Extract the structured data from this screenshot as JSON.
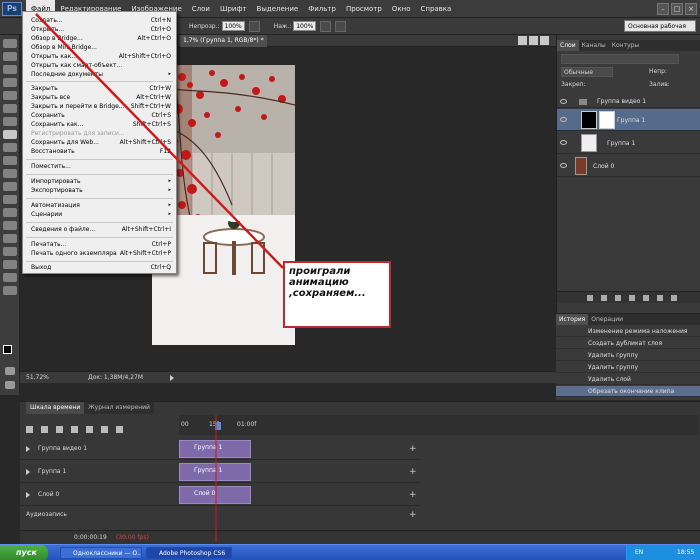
{
  "app": {
    "logo": "Ps",
    "menus": [
      "Файл",
      "Редактирование",
      "Изображение",
      "Слои",
      "Шрифт",
      "Выделение",
      "Фильтр",
      "Просмотр",
      "Окно",
      "Справка"
    ],
    "active_menu": "Файл"
  },
  "options_bar": {
    "opacity_label": "Непрозр.:",
    "opacity_value": "100%",
    "flow_label": "Наж.:",
    "flow_value": "100%",
    "workspace": "Основная рабочая среда"
  },
  "document": {
    "tab_title": "1,7% (Группа 1, RGB/8*) *",
    "zoom": "51,72%",
    "doc_size": "Док: 1,38M/4,27M"
  },
  "file_menu": {
    "items": [
      {
        "label": "Создать...",
        "shortcut": "Ctrl+N"
      },
      {
        "label": "Открыть...",
        "shortcut": "Ctrl+O"
      },
      {
        "label": "Обзор в Bridge...",
        "shortcut": "Alt+Ctrl+O"
      },
      {
        "label": "Обзор в Mini Bridge...",
        "shortcut": ""
      },
      {
        "label": "Открыть как...",
        "shortcut": "Alt+Shift+Ctrl+O"
      },
      {
        "label": "Открыть как смарт-объект...",
        "shortcut": ""
      },
      {
        "label": "Последние документы",
        "shortcut": "▸"
      },
      {
        "label": "Закрыть",
        "shortcut": "Ctrl+W"
      },
      {
        "label": "Закрыть все",
        "shortcut": "Alt+Ctrl+W"
      },
      {
        "label": "Закрыть и перейти в Bridge...",
        "shortcut": "Shift+Ctrl+W"
      },
      {
        "label": "Сохранить",
        "shortcut": "Ctrl+S"
      },
      {
        "label": "Сохранить как...",
        "shortcut": "Shift+Ctrl+S"
      },
      {
        "label": "Регистрировать для записи...",
        "shortcut": ""
      },
      {
        "label": "Сохранить для Web...",
        "shortcut": "Alt+Shift+Ctrl+S"
      },
      {
        "label": "Восстановить",
        "shortcut": "F12"
      },
      {
        "label": "Поместить...",
        "shortcut": ""
      },
      {
        "label": "Импортировать",
        "shortcut": "▸"
      },
      {
        "label": "Экспортировать",
        "shortcut": "▸"
      },
      {
        "label": "Автоматизация",
        "shortcut": "▸"
      },
      {
        "label": "Сценарии",
        "shortcut": "▸"
      },
      {
        "label": "Сведения о файле...",
        "shortcut": "Alt+Shift+Ctrl+I"
      },
      {
        "label": "Печатать...",
        "shortcut": "Ctrl+P"
      },
      {
        "label": "Печать одного экземпляра",
        "shortcut": "Alt+Shift+Ctrl+P"
      },
      {
        "label": "Выход",
        "shortcut": "Ctrl+Q"
      }
    ]
  },
  "layers_panel": {
    "tabs": [
      "Слои",
      "Каналы",
      "Контуры"
    ],
    "blend_mode": "Обычные",
    "opacity_label": "Непр:",
    "fill_label": "Залив:",
    "lock_label": "Закреп:",
    "layers": [
      {
        "name": "Группа видео 1"
      },
      {
        "name": "Группа 1"
      },
      {
        "name": "Группа 1"
      },
      {
        "name": "Слой 0"
      }
    ]
  },
  "history_panel": {
    "tabs": [
      "История",
      "Операции"
    ],
    "items": [
      "Изменение режима наложения",
      "Создать дубликат слоя",
      "Удалить группу",
      "Удалить группу",
      "Удалить слой",
      "Обрезать окончание клипа"
    ]
  },
  "timeline": {
    "tabs": [
      "Шкала времени",
      "Журнал измерений"
    ],
    "ruler": [
      "00",
      "15f",
      "01:00f"
    ],
    "tracks": [
      {
        "name": "Группа видео 1",
        "clip": "Группа 1"
      },
      {
        "name": "Группа 1",
        "clip": "Группа 1"
      },
      {
        "name": "Слой 0",
        "clip": "Слой 0"
      }
    ],
    "audio_label": "Аудиозапись",
    "timecode": "0:00:00:19",
    "fps": "(30,00 fps)"
  },
  "annotation": {
    "text": "проиграли анимацию ,сохраняем..."
  },
  "taskbar": {
    "start": "пуск",
    "tasks": [
      "Одноклассники — О...",
      "Adobe Photoshop CS6"
    ],
    "lang": "EN",
    "clock": "18:55"
  }
}
